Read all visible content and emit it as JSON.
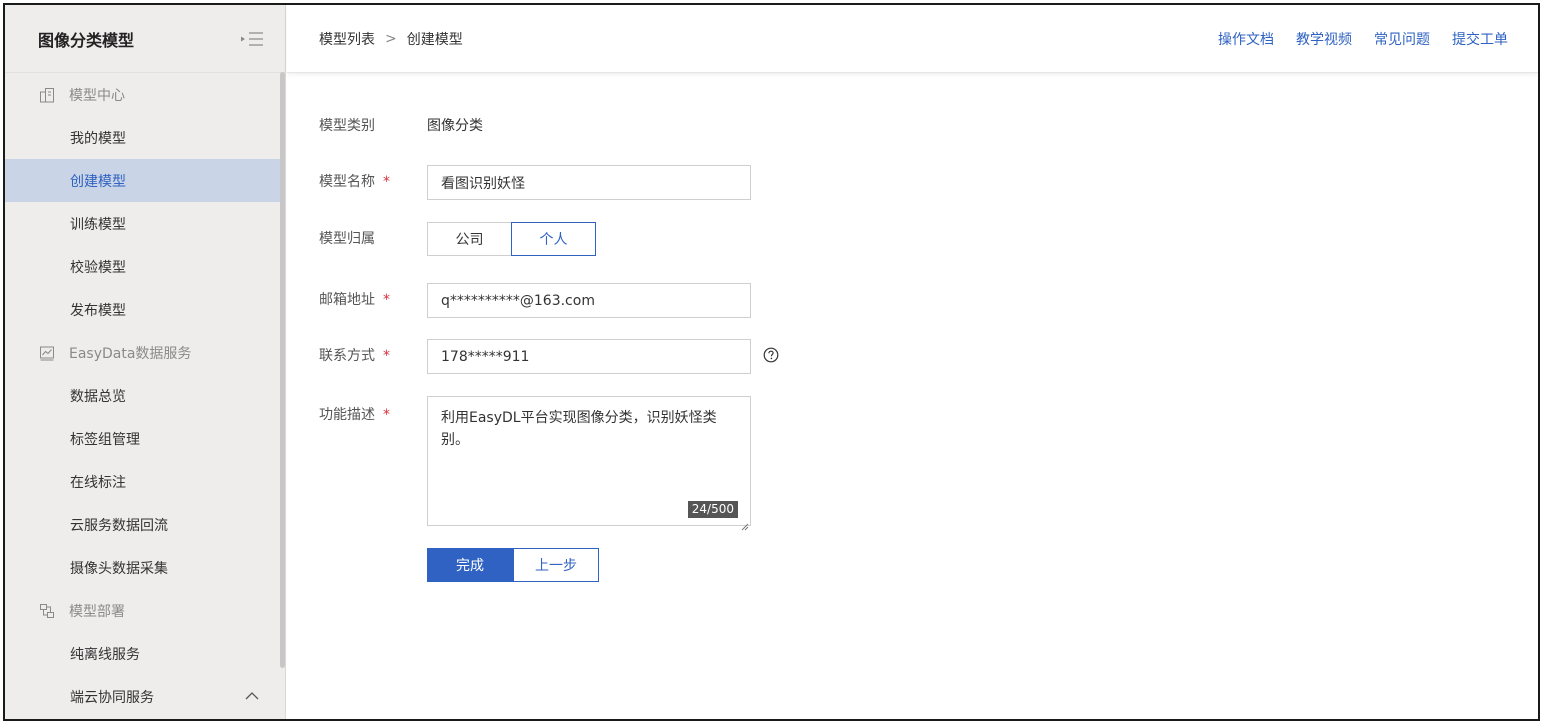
{
  "sidebar": {
    "title": "图像分类模型",
    "groups": [
      {
        "label": "模型中心",
        "items": [
          "我的模型",
          "创建模型",
          "训练模型",
          "校验模型",
          "发布模型"
        ]
      },
      {
        "label": "EasyData数据服务",
        "items": [
          "数据总览",
          "标签组管理",
          "在线标注",
          "云服务数据回流",
          "摄像头数据采集"
        ]
      },
      {
        "label": "模型部署",
        "items": [
          "纯离线服务",
          "端云协同服务"
        ]
      }
    ],
    "active_item": "创建模型"
  },
  "header": {
    "breadcrumb": [
      "模型列表",
      "创建模型"
    ],
    "breadcrumb_sep": ">",
    "links": [
      "操作文档",
      "教学视频",
      "常见问题",
      "提交工单"
    ]
  },
  "form": {
    "category_label": "模型类别",
    "category_value": "图像分类",
    "name_label": "模型名称",
    "name_value": "看图识别妖怪",
    "owner_label": "模型归属",
    "owner_options": [
      "公司",
      "个人"
    ],
    "owner_selected": "个人",
    "email_label": "邮箱地址",
    "email_value": "q**********@163.com",
    "contact_label": "联系方式",
    "contact_value": "178*****911",
    "desc_label": "功能描述",
    "desc_value": "利用EasyDL平台实现图像分类，识别妖怪类别。",
    "desc_counter": "24/500",
    "required_mark": "*",
    "submit_label": "完成",
    "back_label": "上一步"
  },
  "colors": {
    "accent": "#2f62c2",
    "required": "#d9303b",
    "sidebar_bg": "#efecec",
    "active_bg": "#c9d4e6"
  }
}
